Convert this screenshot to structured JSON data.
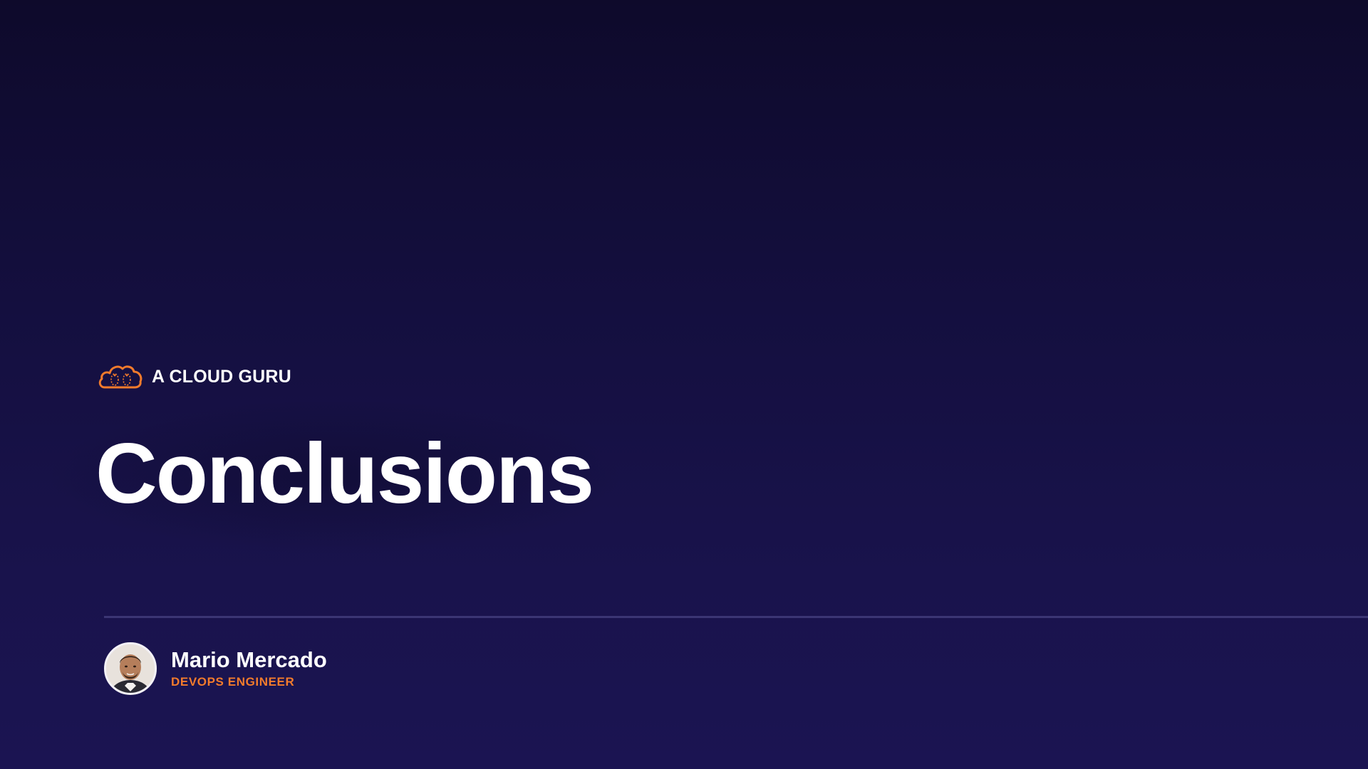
{
  "brand": {
    "name": "A CLOUD GURU",
    "logo_icon": "cloud-logo-icon",
    "logo_color": "#f27b2c"
  },
  "slide": {
    "title": "Conclusions"
  },
  "presenter": {
    "name": "Mario Mercado",
    "role": "DEVOPS ENGINEER",
    "avatar_icon": "avatar-photo",
    "role_color": "#f27b2c"
  },
  "colors": {
    "background_top": "#0e0a2b",
    "background_bottom": "#1b1452",
    "divider": "#3b3573",
    "text": "#ffffff"
  }
}
